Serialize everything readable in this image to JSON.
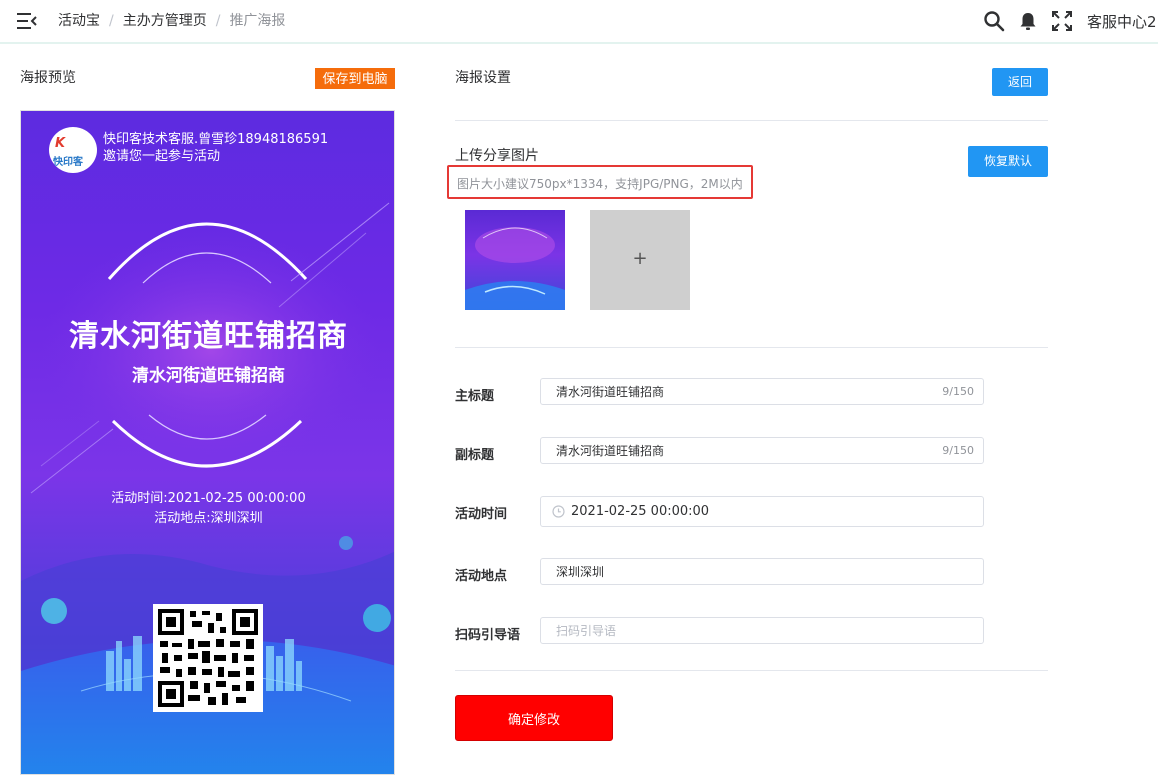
{
  "header": {
    "breadcrumb": [
      "活动宝",
      "主办方管理页",
      "推广海报"
    ],
    "separator": "/",
    "user_label": "客服中心2"
  },
  "icons": {
    "menu": "menu-fold-icon",
    "search": "search-icon",
    "bell": "bell-icon",
    "fullscreen": "fullscreen-icon",
    "clock": "clock-icon"
  },
  "preview": {
    "title": "海报预览",
    "save_label": "保存到电脑",
    "poster": {
      "logo_top": "K",
      "logo_bottom": "快印客",
      "org_line": "快印客技术客服.曾雪珍18948186591",
      "invite_line": "邀请您一起参与活动",
      "main_title": "清水河街道旺铺招商",
      "sub_title": "清水河街道旺铺招商",
      "time_line": "活动时间:2021-02-25 00:00:00",
      "place_line": "活动地点:深圳深圳"
    }
  },
  "settings": {
    "title": "海报设置",
    "back_label": "返回",
    "upload": {
      "title": "上传分享图片",
      "hint": "图片大小建议750px*1334，支持JPG/PNG，2M以内",
      "reset_label": "恢复默认",
      "add_symbol": "+"
    },
    "fields": {
      "main_title": {
        "label": "主标题",
        "value": "清水河街道旺铺招商",
        "count": "9/150"
      },
      "sub_title": {
        "label": "副标题",
        "value": "清水河街道旺铺招商",
        "count": "9/150"
      },
      "time": {
        "label": "活动时间",
        "value": "2021-02-25 00:00:00"
      },
      "place": {
        "label": "活动地点",
        "value": "深圳深圳"
      },
      "guide": {
        "label": "扫码引导语",
        "value": "",
        "placeholder": "扫码引导语"
      }
    },
    "confirm_label": "确定修改"
  },
  "colors": {
    "accent_blue": "#2196f3",
    "save_orange": "#f56c0b",
    "confirm_red": "#ff0000",
    "highlight_red": "#e53935"
  }
}
